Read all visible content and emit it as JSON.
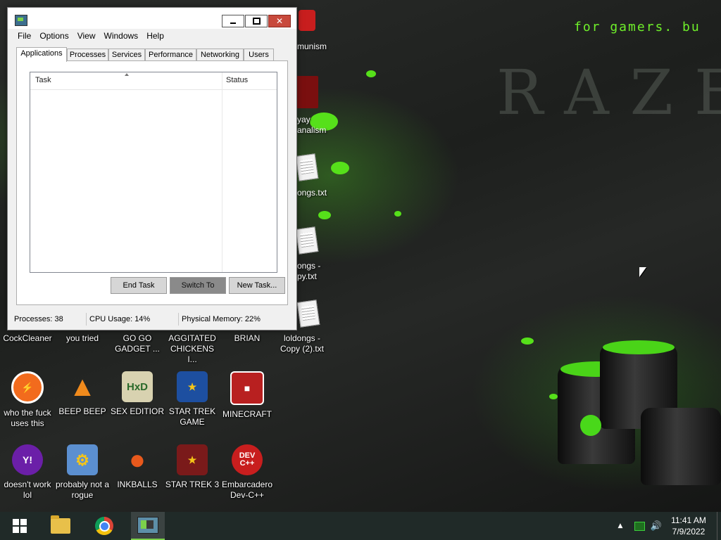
{
  "desktop": {
    "tagline": "for gamers. bu",
    "watermark": "RAZE",
    "partial_labels": [
      "munism",
      "yay",
      "analism",
      "ongs.txt",
      "ongs -",
      "py.txt"
    ],
    "icons": [
      {
        "label": "CockCleaner",
        "glyph": "",
        "color": "#2a6ab0",
        "icon": "cleaner-icon"
      },
      {
        "label": "you tried",
        "glyph": "",
        "color": "#333",
        "icon": "shortcut-icon"
      },
      {
        "label": "GO GO GADGET ...",
        "glyph": "",
        "color": "#333",
        "icon": "shortcut-icon"
      },
      {
        "label": "AGGITATED CHICKENS I...",
        "glyph": "",
        "color": "#333",
        "icon": "shortcut-icon"
      },
      {
        "label": "BRIAN",
        "glyph": "",
        "color": "#333",
        "icon": "shortcut-icon"
      },
      {
        "label": "loldongs - Copy (2).txt",
        "glyph": "",
        "color": "#333",
        "icon": "text-file-icon"
      },
      {
        "label": "who the fuck uses this",
        "glyph": "⚡",
        "color": "#f26b1d",
        "icon": "flash-icon"
      },
      {
        "label": "BEEP BEEP",
        "glyph": "▲",
        "color": "#f08a1c",
        "icon": "vlc-cone-icon"
      },
      {
        "label": "SEX EDITIOR",
        "glyph": "HxD",
        "color": "#d8d2b0",
        "icon": "hex-editor-icon"
      },
      {
        "label": "STAR TREK GAME",
        "glyph": "★",
        "color": "#1d4fa0",
        "icon": "angry-birds-star-wars-icon"
      },
      {
        "label": "MINECRAFT",
        "glyph": "■",
        "color": "#b82020",
        "icon": "minecraft-bird-icon"
      },
      {
        "label": "doesn't work lol",
        "glyph": "Y!",
        "color": "#6b1fa8",
        "icon": "yahoo-messenger-icon"
      },
      {
        "label": "probably not a rogue",
        "glyph": "⚙",
        "color": "#5b8fd0",
        "icon": "settings-monitor-icon"
      },
      {
        "label": "INKBALLS",
        "glyph": "●",
        "color": "#e8591c",
        "icon": "inkball-icon"
      },
      {
        "label": "STAR TREK 3",
        "glyph": "★",
        "color": "#7a1a1a",
        "icon": "star-wars-game-icon"
      },
      {
        "label": "Embarcadero Dev-C++",
        "glyph": "DEV C++",
        "color": "#c81e1e",
        "icon": "dev-cpp-icon"
      }
    ]
  },
  "task_manager": {
    "menu": [
      "File",
      "Options",
      "View",
      "Windows",
      "Help"
    ],
    "tabs": [
      "Applications",
      "Processes",
      "Services",
      "Performance",
      "Networking",
      "Users"
    ],
    "active_tab": "Applications",
    "columns": {
      "task": "Task",
      "status": "Status"
    },
    "buttons": {
      "end_task": "End Task",
      "switch_to": "Switch To",
      "new_task": "New Task..."
    },
    "status": {
      "processes": "Processes: 38",
      "cpu": "CPU Usage: 14%",
      "memory": "Physical Memory: 22%"
    },
    "close_glyph": "✕"
  },
  "taskbar": {
    "pinned": [
      "start-button",
      "file-explorer",
      "google-chrome",
      "task-manager"
    ],
    "tray_arrow": "▲",
    "volume_glyph": "🔊",
    "time": "11:41 AM",
    "date": "7/9/2022"
  }
}
